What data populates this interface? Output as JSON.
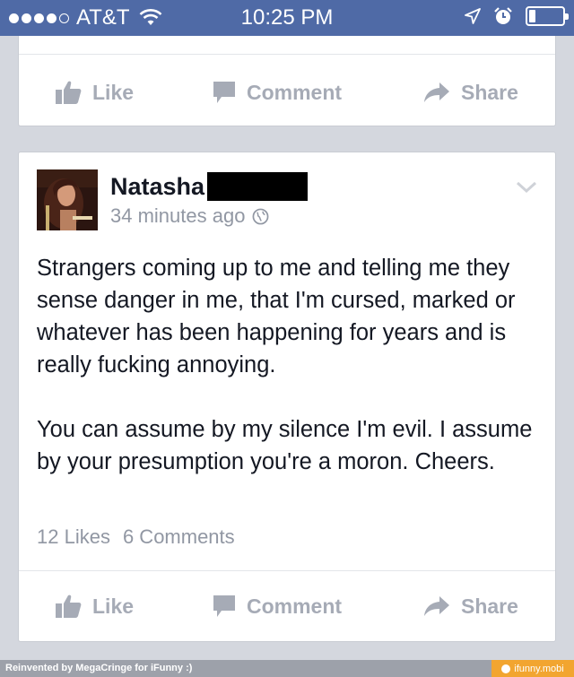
{
  "status_bar": {
    "carrier": "AT&T",
    "time": "10:25 PM",
    "signal_bars_filled": 4,
    "signal_bars_total": 5,
    "battery_level": 0.2
  },
  "previous_post": {
    "actions": {
      "like": "Like",
      "comment": "Comment",
      "share": "Share"
    }
  },
  "post": {
    "author": "Natasha",
    "timestamp": "34 minutes ago",
    "privacy_icon": "globe-icon",
    "body_paragraphs": [
      "Strangers coming up to me and telling me they sense danger in me, that I'm cursed, marked or whatever has been happening for years and is really fucking annoying.",
      "You can assume by my silence I'm evil. I assume by your presumption you're a moron. Cheers."
    ],
    "likes": "12 Likes",
    "comments": "6 Comments",
    "actions": {
      "like": "Like",
      "comment": "Comment",
      "share": "Share"
    }
  },
  "footer": {
    "credit": "Reinvented by MegaCringe for iFunny :)",
    "brand": "ifunny.mobi"
  },
  "colors": {
    "status_bar": "#4f6aa6",
    "background": "#d4d7de",
    "action_gray": "#a6abb6",
    "text": "#141823",
    "meta_gray": "#9197a3",
    "brand_orange": "#f2a530"
  }
}
